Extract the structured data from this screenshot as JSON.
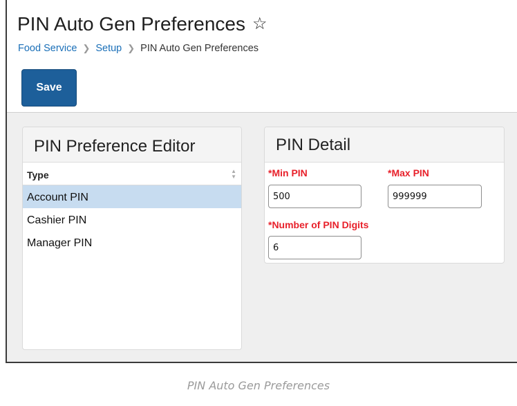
{
  "header": {
    "title": "PIN Auto Gen Preferences",
    "breadcrumb": [
      "Food Service",
      "Setup",
      "PIN Auto Gen Preferences"
    ]
  },
  "toolbar": {
    "save_label": "Save"
  },
  "editor": {
    "title": "PIN Preference Editor",
    "column_header": "Type",
    "items": [
      {
        "label": "Account PIN",
        "selected": true
      },
      {
        "label": "Cashier PIN",
        "selected": false
      },
      {
        "label": "Manager PIN",
        "selected": false
      }
    ]
  },
  "detail": {
    "title": "PIN Detail",
    "min_pin": {
      "label": "*Min PIN",
      "value": "500"
    },
    "max_pin": {
      "label": "*Max PIN",
      "value": "999999"
    },
    "num_digits": {
      "label": "*Number of PIN Digits",
      "value": "6"
    }
  },
  "caption": "PIN Auto Gen Preferences",
  "colors": {
    "primary": "#1d5f9a",
    "required": "#e8202a",
    "selected_row": "#c7dcf0",
    "link": "#1a6fb8"
  },
  "icons": {
    "favorite": "star-outline-icon",
    "separator": "chevron-right-icon",
    "sort": "sort-icon"
  }
}
